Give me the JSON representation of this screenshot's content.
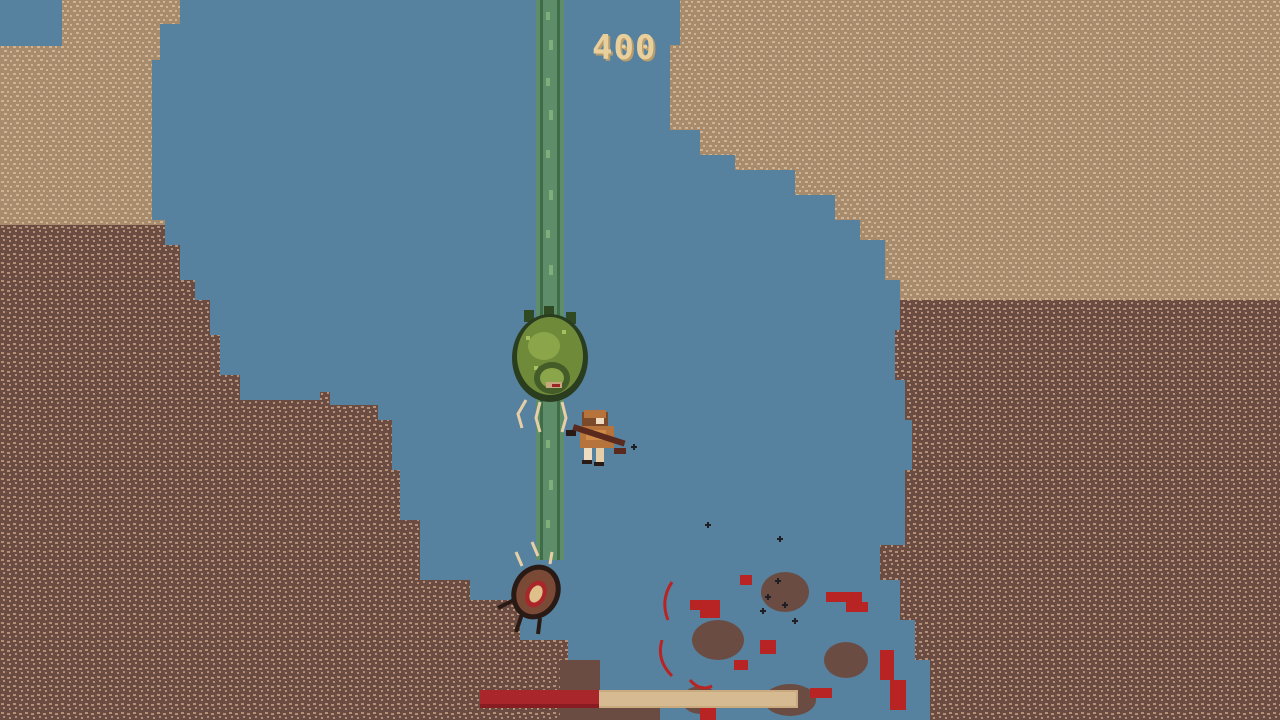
{
  "hud": {
    "score": "400",
    "health_fraction": 0.375,
    "health_color": "#a9262a",
    "health_empty_color": "#d6bb92"
  },
  "palette": {
    "water": "#56829f",
    "rock_light": "#a88a6c",
    "rock_dark": "#6b4c43",
    "speckle_light": "#cdb591",
    "speckle_dark": "#b58f76",
    "beam": "#5f8f60",
    "blood": "#b82424"
  },
  "icons": {
    "player": "soldier-with-rifle-icon",
    "enemy_main": "green-shell-beetle-icon",
    "enemy_small": "brown-crab-bug-icon"
  }
}
